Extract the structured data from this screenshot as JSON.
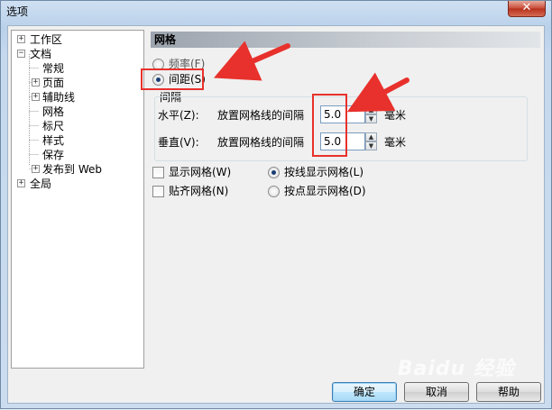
{
  "window": {
    "title": "选项",
    "close_glyph": "✕"
  },
  "tree": {
    "items": [
      {
        "label": "工作区",
        "expander": "+"
      },
      {
        "label": "文档",
        "expander": "−"
      },
      {
        "label": "常规"
      },
      {
        "label": "页面",
        "expander": "+"
      },
      {
        "label": "辅助线",
        "expander": "+"
      },
      {
        "label": "网格"
      },
      {
        "label": "标尺"
      },
      {
        "label": "样式"
      },
      {
        "label": "保存"
      },
      {
        "label": "发布到 Web",
        "expander": "+"
      },
      {
        "label": "全局",
        "expander": "+"
      }
    ]
  },
  "panel": {
    "header": "网格",
    "frequency_label": "频率(F)",
    "spacing_label": "间距(S)",
    "group_label": "间隔",
    "horizontal": {
      "label": "水平(Z):",
      "desc": "放置网格线的间隔",
      "value": "5.0",
      "unit": "毫米"
    },
    "vertical": {
      "label": "垂直(V):",
      "desc": "放置网格线的间隔",
      "value": "5.0",
      "unit": "毫米"
    },
    "show_grid": "显示网格(W)",
    "snap_grid": "贴齐网格(N)",
    "show_as_lines": "按线显示网格(L)",
    "show_as_dots": "按点显示网格(D)"
  },
  "buttons": {
    "ok": "确定",
    "cancel": "取消",
    "help": "帮助"
  },
  "watermark": "Baidu 经验",
  "colors": {
    "annotation": "#e8312c",
    "default_button_border": "#3c7fb1"
  }
}
